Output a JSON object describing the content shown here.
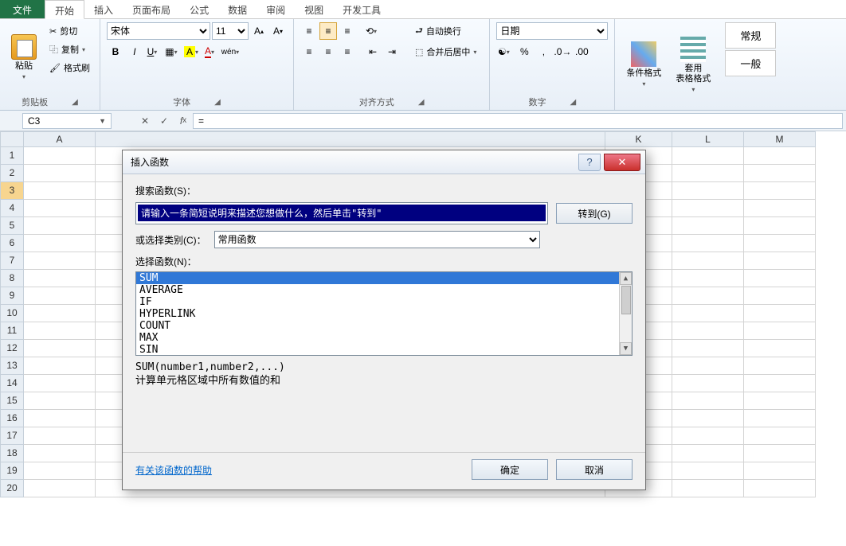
{
  "tabs": {
    "file": "文件",
    "home": "开始",
    "insert": "插入",
    "layout": "页面布局",
    "formula": "公式",
    "data": "数据",
    "review": "审阅",
    "view": "视图",
    "dev": "开发工具"
  },
  "ribbon": {
    "clipboard": {
      "title": "剪贴板",
      "paste": "粘贴",
      "cut": "剪切",
      "copy": "复制",
      "brush": "格式刷"
    },
    "font": {
      "title": "字体",
      "name": "宋体",
      "size": "11",
      "bold": "B",
      "italic": "I",
      "underline": "U",
      "pinyin": "wén"
    },
    "align": {
      "title": "对齐方式",
      "wrap": "自动换行",
      "merge": "合并后居中"
    },
    "number": {
      "title": "数字",
      "format": "日期"
    },
    "styles": {
      "cond": "条件格式",
      "tbl": "套用\n表格格式",
      "general1": "常规",
      "general2": "一般"
    }
  },
  "fbar": {
    "name": "C3",
    "formula": "="
  },
  "cols": [
    "A",
    "",
    "",
    "",
    "",
    "",
    "",
    "",
    "",
    "K",
    "L",
    "M"
  ],
  "dialog": {
    "title": "插入函数",
    "searchLabel": "搜索函数(S)：",
    "searchText": "请输入一条简短说明来描述您想做什么，然后单击\"转到\"",
    "go": "转到(G)",
    "catLabel": "或选择类别(C)：",
    "catValue": "常用函数",
    "listLabel": "选择函数(N)：",
    "fns": [
      "SUM",
      "AVERAGE",
      "IF",
      "HYPERLINK",
      "COUNT",
      "MAX",
      "SIN"
    ],
    "sig": "SUM(number1,number2,...)",
    "desc": "计算单元格区域中所有数值的和",
    "help": "有关该函数的帮助",
    "ok": "确定",
    "cancel": "取消"
  }
}
